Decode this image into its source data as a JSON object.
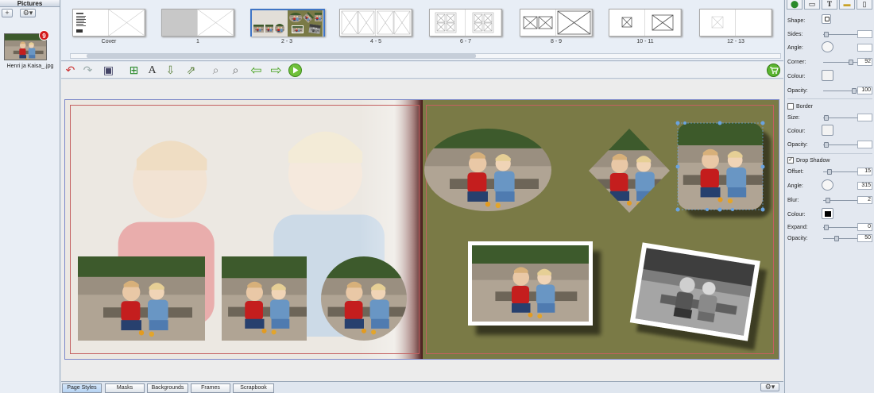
{
  "pictures_panel": {
    "title": "Pictures",
    "add_label": "+",
    "settings_label": "⚙▾",
    "items": [
      {
        "filename": "Henri ja Kaisa_.jpg",
        "badge": "9"
      }
    ]
  },
  "spreads": [
    {
      "label": "Cover"
    },
    {
      "label": "1"
    },
    {
      "label": "2 - 3"
    },
    {
      "label": "4 - 5"
    },
    {
      "label": "6 - 7"
    },
    {
      "label": "8 - 9"
    },
    {
      "label": "10 - 11"
    },
    {
      "label": "12 - 13"
    }
  ],
  "toolbar": {
    "buttons": [
      {
        "name": "undo-icon",
        "glyph": "↶"
      },
      {
        "name": "redo-icon",
        "glyph": "↷"
      },
      {
        "name": "save-icon",
        "glyph": "💾"
      },
      {
        "name": "add-photo-icon",
        "glyph": "🖼"
      },
      {
        "name": "add-text-icon",
        "glyph": "A"
      },
      {
        "name": "insert-page-icon",
        "glyph": "📥"
      },
      {
        "name": "move-page-icon",
        "glyph": "📤"
      },
      {
        "name": "zoom-out-icon",
        "glyph": "🔍"
      },
      {
        "name": "zoom-in-icon",
        "glyph": "🔎"
      },
      {
        "name": "arrow-left-icon",
        "glyph": "⇦"
      },
      {
        "name": "arrow-right-icon",
        "glyph": "⇨"
      },
      {
        "name": "play-icon",
        "glyph": "▶"
      }
    ],
    "cart_icon": "cart-icon"
  },
  "bottom_tabs": [
    "Page Styles",
    "Masks",
    "Backgrounds",
    "Frames",
    "Scrapbook"
  ],
  "bottom_settings_label": "⚙▾",
  "properties": {
    "tabs": [
      "⬤",
      "▭",
      "T",
      "▬",
      "▯"
    ],
    "shape_label": "Shape:",
    "sides_label": "Sides:",
    "sides_value": "",
    "angle_label": "Angle:",
    "angle_value": "",
    "corner_label": "Corner:",
    "corner_value": "92",
    "colour_label": "Colour:",
    "opacity_label": "Opacity:",
    "opacity_value": "100",
    "border_label": "Border",
    "border_checked": false,
    "border_size_label": "Size:",
    "border_size_value": "",
    "border_colour_label": "Colour:",
    "border_opacity_label": "Opacity:",
    "border_opacity_value": "",
    "shadow_label": "Drop Shadow",
    "shadow_checked": true,
    "offset_label": "Offset:",
    "offset_value": "15",
    "shadow_angle_label": "Angle:",
    "shadow_angle_value": "315",
    "blur_label": "Blur:",
    "blur_value": "2",
    "shadow_colour_label": "Colour:",
    "expand_label": "Expand:",
    "expand_value": "0",
    "shadow_opacity_label": "Opacity:",
    "shadow_opacity_value": "50"
  },
  "colors": {
    "page_bg": "#7a7a46",
    "shadow": "#000000",
    "accent": "#3a7bd5"
  }
}
